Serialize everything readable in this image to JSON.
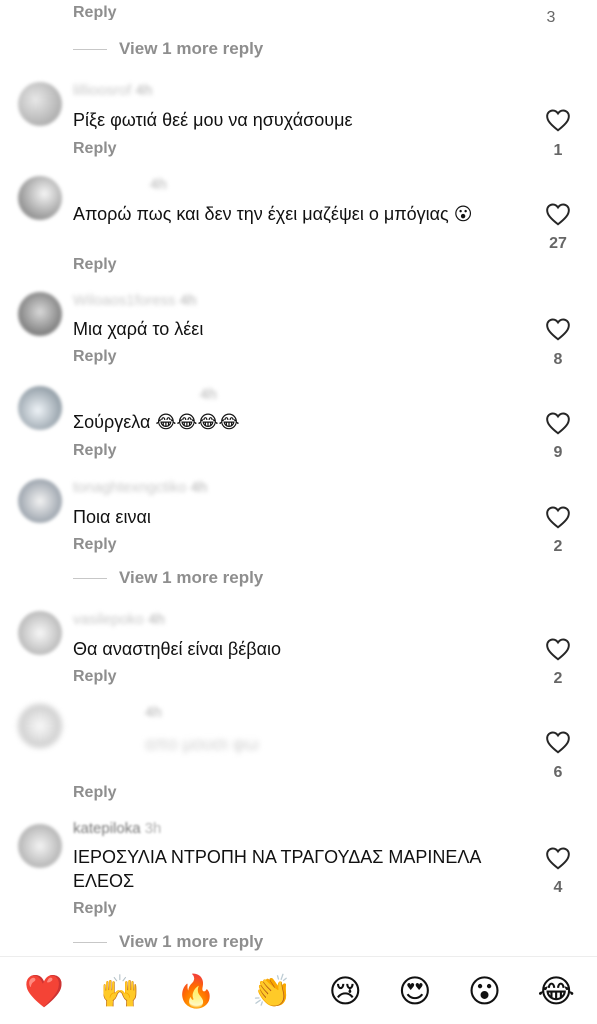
{
  "top": {
    "reply_label": "Reply",
    "like_count": "3",
    "view_more_label": "View 1 more reply"
  },
  "comments": [
    {
      "username": "lillioosrof",
      "time": "4h",
      "text": "Ρίξε φωτιά θεέ μου να ησυχάσουμε",
      "reply_label": "Reply",
      "likes": "1"
    },
    {
      "username": "",
      "time": "4h",
      "text": "Απορώ πως και δεν την έχει μαζέψει ο μπόγιας 😮",
      "reply_label": "Reply",
      "likes": "27"
    },
    {
      "username": "Wiloaos1foress",
      "time": "4h",
      "text": "Μια χαρά το λέει",
      "reply_label": "Reply",
      "likes": "8"
    },
    {
      "username": "",
      "time": "4h",
      "text": "Σούργελα 😂😂😂😂",
      "reply_label": "Reply",
      "likes": "9"
    },
    {
      "username": "tonaghtexngctiko",
      "time": "4h",
      "text": "Ποια ειναι",
      "reply_label": "Reply",
      "likes": "2",
      "view_more_label": "View 1 more reply"
    },
    {
      "username": "vasilepoko",
      "time": "4h",
      "text": "Θα αναστηθεί είναι βέβαιο",
      "reply_label": "Reply",
      "likes": "2"
    },
    {
      "username": "",
      "time": "4h",
      "text": "απο μουσι φω",
      "reply_label": "Reply",
      "likes": "6"
    },
    {
      "username": "katepiloka",
      "time": "3h",
      "text": "ΙΕΡΟΣΥΛΙΑ  ΝΤΡΟΠΗ ΝΑ ΤΡΑΓΟΥΔΑΣ ΜΑΡΙΝΕΛΑ  ΕΛΕΟΣ",
      "reply_label": "Reply",
      "likes": "4",
      "view_more_label": "View 1 more reply"
    }
  ],
  "emoji_bar": [
    "❤️",
    "🙌",
    "🔥",
    "👏",
    "😢",
    "😍",
    "😮",
    "😂"
  ],
  "colors": {
    "secondary_text": "#8e8e8e",
    "primary_text": "#111111",
    "heart_stroke": "#262626"
  }
}
